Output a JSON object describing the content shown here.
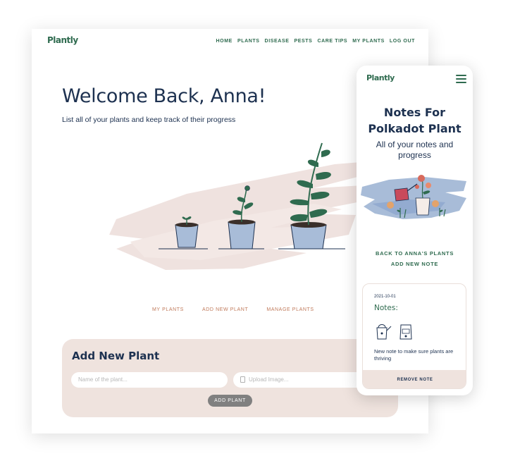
{
  "desktop": {
    "logo": "Plantly",
    "nav": [
      "HOME",
      "PLANTS",
      "DISEASE",
      "PESTS",
      "CARE TIPS",
      "MY PLANTS",
      "LOG OUT"
    ],
    "welcome": "Welcome Back, Anna!",
    "subtitle": "List all of your plants and keep track of their progress",
    "links": [
      "MY PLANTS",
      "ADD NEW PLANT",
      "MANAGE PLANTS"
    ],
    "add_panel": {
      "title": "Add New Plant",
      "name_placeholder": "Name of the plant...",
      "upload_placeholder": "Upload Image...",
      "button": "ADD PLANT"
    }
  },
  "phone": {
    "logo": "Plantly",
    "title_line1": "Notes For",
    "title_line2": "Polkadot Plant",
    "subtitle": "All of your notes and progress",
    "back_link": "BACK TO ANNA'S PLANTS",
    "add_note_link": "ADD NEW NOTE",
    "note": {
      "date": "2021-10-01",
      "label": "Notes:",
      "text": "New note to make sure plants are thriving",
      "remove_button": "REMOVE NOTE"
    }
  },
  "colors": {
    "brand_green": "#2f6b4f",
    "navy": "#1d3150",
    "blush": "#efe3de",
    "terracotta": "#c07a5b"
  },
  "icons": [
    "menu-icon",
    "document-icon",
    "watering-can-icon",
    "fertilizer-bag-icon"
  ]
}
